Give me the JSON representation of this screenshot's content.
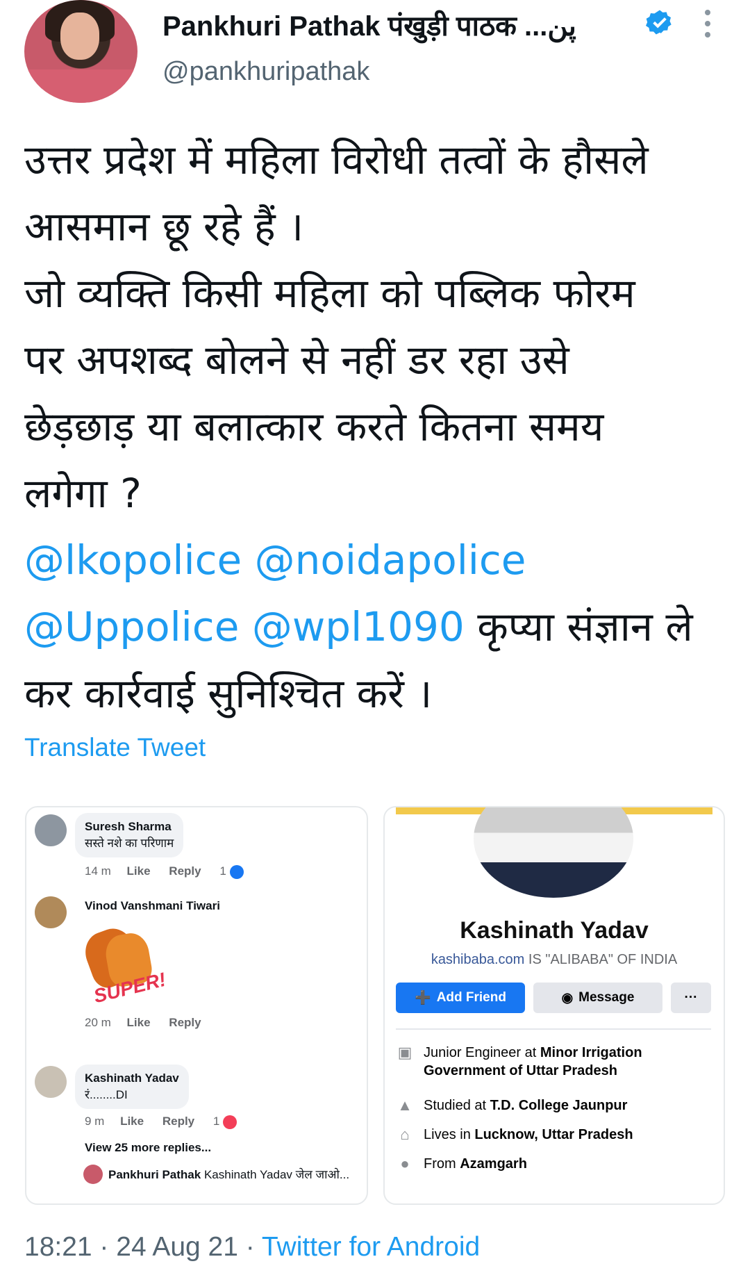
{
  "header": {
    "display_name": "Pankhuri Pathak पंखुड़ी पाठक ...پن",
    "handle": "@pankhuripathak"
  },
  "tweet": {
    "line1": "उत्तर प्रदेश में महिला विरोधी तत्वों के हौसले",
    "line2": "आसमान छू रहे हैं ।",
    "line3": "जो व्यक्ति किसी महिला को पब्लिक फोरम",
    "line4": "पर अपशब्द बोलने से नहीं डर रहा उसे",
    "line5": "छेड़छाड़ या बलात्कार करते कितना समय",
    "line6": "लगेगा ?",
    "mention1": "@lkopolice",
    "mention2": "@noidapolice",
    "mention3": "@Uppolice",
    "mention4": "@wpl1090",
    "line7_rest": "कृप्या संज्ञान ले",
    "line8": "कर कार्रवाई सुनिश्चित करें ।",
    "translate_label": "Translate Tweet"
  },
  "comments": {
    "c1": {
      "name": "Suresh Sharma",
      "text": "सस्ते नशे का परिणाम",
      "time": "14 m",
      "like": "Like",
      "reply": "Reply",
      "count": "1"
    },
    "c2": {
      "name": "Vinod Vanshmani Tiwari",
      "sticker_text": "SUPER!",
      "time": "20 m",
      "like": "Like",
      "reply": "Reply"
    },
    "c3": {
      "name": "Kashinath Yadav",
      "text": "रं........DI",
      "time": "9 m",
      "like": "Like",
      "reply": "Reply",
      "count": "1"
    },
    "more_replies": "View 25 more replies...",
    "reply_name": "Pankhuri Pathak",
    "reply_text": "Kashinath Yadav जेल जाओ..."
  },
  "profile": {
    "name": "Kashinath Yadav",
    "link": "kashibaba.com",
    "tagline": " IS \"ALIBABA\" OF INDIA",
    "add_friend": "Add Friend",
    "message": "Message",
    "dots": "···",
    "work_prefix": "Junior Engineer at ",
    "work_bold": "Minor Irrigation Government of Uttar Pradesh",
    "study_prefix": "Studied at ",
    "study_bold": "T.D. College Jaunpur",
    "lives_prefix": "Lives in ",
    "lives_bold": "Lucknow, Uttar Pradesh",
    "from_prefix": "From ",
    "from_bold": "Azamgarh"
  },
  "footer": {
    "time": "18:21 · 24 Aug 21 · ",
    "source": "Twitter for Android"
  },
  "colors": {
    "accent": "#1d9bf0",
    "fb_blue": "#1877f2",
    "muted": "#536471"
  }
}
